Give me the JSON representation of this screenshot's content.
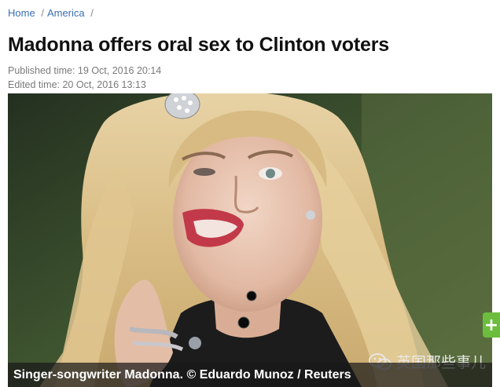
{
  "breadcrumb": {
    "items": [
      {
        "label": "Home"
      },
      {
        "label": "America"
      }
    ],
    "separator": "/"
  },
  "article": {
    "title": "Madonna offers oral sex to Clinton voters",
    "published": "Published time: 19 Oct, 2016 20:14",
    "edited": "Edited time: 20 Oct, 2016 13:13"
  },
  "photo": {
    "caption": "Singer-songwriter Madonna. © Eduardo Munoz / Reuters",
    "watermark": "英国那些事儿",
    "watermark_icon": "wechat-icon"
  },
  "side_button": {
    "label": "+",
    "color": "#6cbd3e"
  },
  "colors": {
    "link": "#3b6fb6",
    "meta": "#7a7a7a"
  }
}
